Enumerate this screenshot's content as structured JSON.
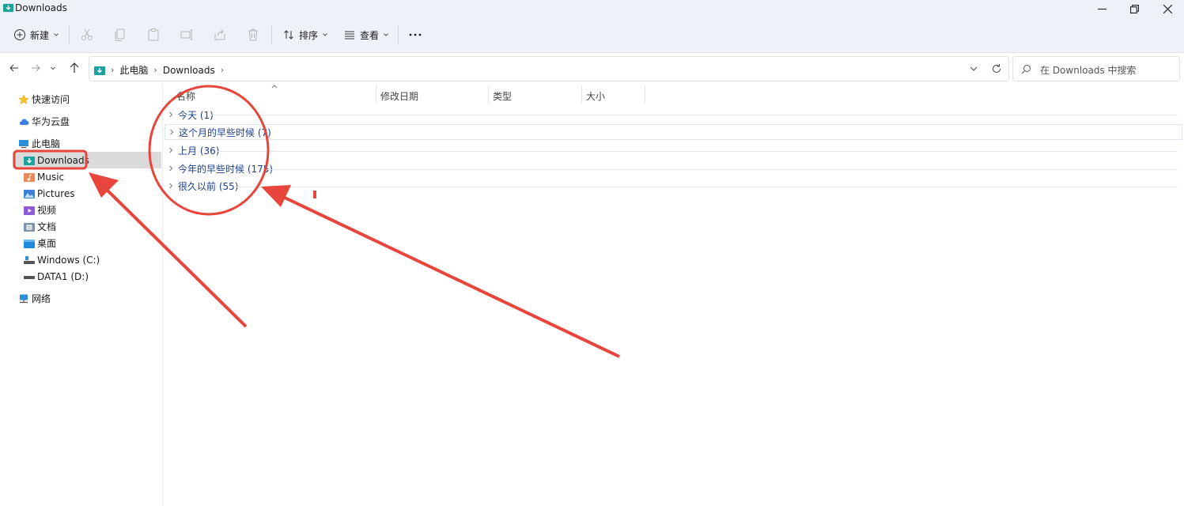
{
  "window": {
    "title": "Downloads",
    "accent": "#0f7fa8",
    "annotation_color": "#e8453c"
  },
  "toolbar": {
    "new_label": "新建",
    "sort_label": "排序",
    "view_label": "查看",
    "icons": [
      "cut-icon",
      "copy-icon",
      "paste-icon",
      "rename-icon",
      "share-icon",
      "delete-icon",
      "more-icon"
    ]
  },
  "address": {
    "crumbs": [
      "此电脑",
      "Downloads"
    ],
    "search_placeholder": "在 Downloads 中搜索"
  },
  "sidebar": {
    "items": [
      {
        "label": "快速访问",
        "icon": "star-icon"
      },
      {
        "label": "华为云盘",
        "icon": "cloud-icon"
      },
      {
        "label": "此电脑",
        "icon": "computer-icon"
      },
      {
        "label": "Downloads",
        "icon": "downloads-folder-icon"
      },
      {
        "label": "Music",
        "icon": "music-folder-icon"
      },
      {
        "label": "Pictures",
        "icon": "pictures-folder-icon"
      },
      {
        "label": "视频",
        "icon": "video-folder-icon"
      },
      {
        "label": "文档",
        "icon": "documents-folder-icon"
      },
      {
        "label": "桌面",
        "icon": "desktop-folder-icon"
      },
      {
        "label": "Windows (C:)",
        "icon": "drive-c-icon"
      },
      {
        "label": "DATA1 (D:)",
        "icon": "drive-d-icon"
      },
      {
        "label": "网络",
        "icon": "network-icon"
      }
    ]
  },
  "columns": {
    "name": "名称",
    "date": "修改日期",
    "type": "类型",
    "size": "大小"
  },
  "groups": [
    {
      "label": "今天 (1)"
    },
    {
      "label": "这个月的早些时候 (7)"
    },
    {
      "label": "上月 (36)"
    },
    {
      "label": "今年的早些时候 (175)"
    },
    {
      "label": "很久以前 (55)"
    }
  ]
}
